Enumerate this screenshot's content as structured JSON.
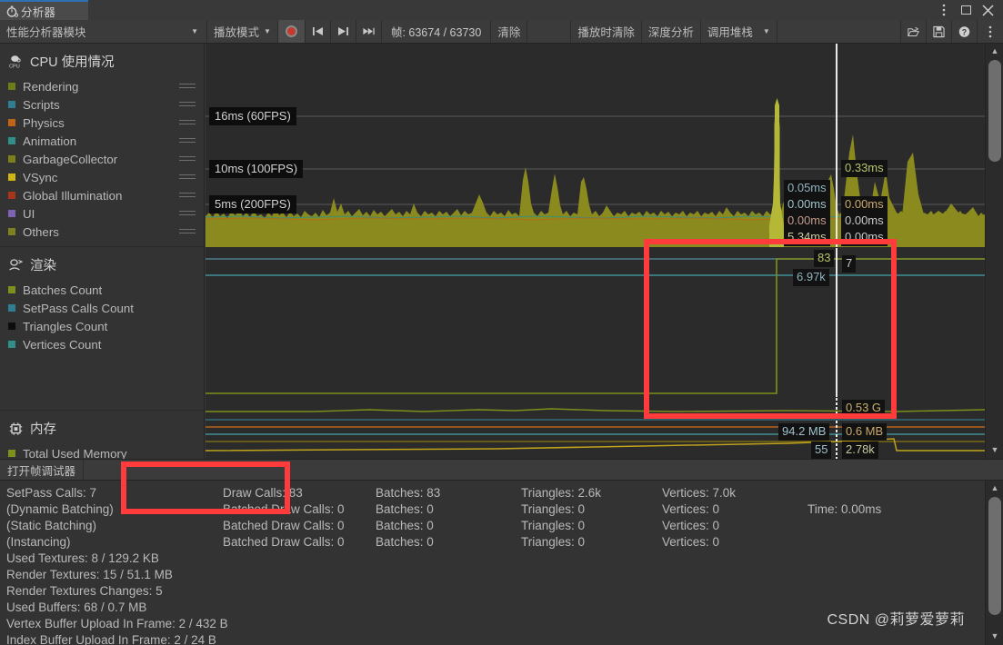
{
  "window": {
    "tab_label": "分析器",
    "tab_icon": "stopwatch-icon",
    "kebab": "⋮",
    "close": "✕"
  },
  "toolbar": {
    "modules_label": "性能分析器模块",
    "play_mode_label": "播放模式",
    "record_icon": "record-icon",
    "prev_frame_icon": "skip-to-start-icon",
    "next_frame_icon": "skip-to-end-icon",
    "last_frame_icon": "fast-forward-icon",
    "frame_label": "帧:  63674 / 63730",
    "clear_label": "清除",
    "clear_on_play_label": "播放时清除",
    "deep_profile_label": "深度分析",
    "call_stacks_label": "调用堆栈",
    "load_icon": "open-folder-icon",
    "save_icon": "save-icon",
    "help_icon": "help-icon",
    "menu_icon": "kebab-icon"
  },
  "modules": [
    {
      "title": "CPU 使用情况",
      "icon": "cpu-icon",
      "charts": [
        {
          "label": "Rendering",
          "color": "#6d7e16"
        },
        {
          "label": "Scripts",
          "color": "#2f7f92"
        },
        {
          "label": "Physics",
          "color": "#bf6415"
        },
        {
          "label": "Animation",
          "color": "#2f8f8a"
        },
        {
          "label": "GarbageCollector",
          "color": "#7e7f19"
        },
        {
          "label": "VSync",
          "color": "#cfb414"
        },
        {
          "label": "Global Illumination",
          "color": "#a83419"
        },
        {
          "label": "UI",
          "color": "#7d62b5"
        },
        {
          "label": "Others",
          "color": "#80801f"
        }
      ]
    },
    {
      "title": "渲染",
      "icon": "rendering-icon",
      "charts": [
        {
          "label": "Batches Count",
          "color": "#7f8f1b"
        },
        {
          "label": "SetPass Calls Count",
          "color": "#2f7f92"
        },
        {
          "label": "Triangles Count",
          "color": "#0d0d0d"
        },
        {
          "label": "Vertices Count",
          "color": "#2f8f8a"
        }
      ]
    },
    {
      "title": "内存",
      "icon": "memory-icon",
      "charts": [
        {
          "label": "Total Used Memory",
          "color": "#7f8f1b"
        }
      ]
    }
  ],
  "chart_data": {
    "type": "area",
    "title": "CPU 使用情况",
    "gridlines": [
      {
        "label": "16ms (60FPS)",
        "value": 16
      },
      {
        "label": "10ms (100FPS)",
        "value": 10
      },
      {
        "label": "5ms (200FPS)",
        "value": 5
      }
    ],
    "ylabel": "ms",
    "ylim": [
      0,
      22
    ],
    "selected_frame": 63674,
    "cpu_tooltips_left": [
      {
        "text": "0.05ms",
        "color": "#8fb3c0"
      },
      {
        "text": "0.00ms",
        "color": "#9fc2cc"
      },
      {
        "text": "0.00ms",
        "color": "#c49a8a"
      },
      {
        "text": "5.34ms",
        "color": "#c9c9a0"
      }
    ],
    "cpu_tooltips_right": [
      {
        "text": "0.33ms",
        "color": "#b8c26a"
      },
      {
        "text": "0.00ms",
        "color": "#c9a86a"
      },
      {
        "text": "0.00ms",
        "color": "#c8c8c8"
      },
      {
        "text": "0.00ms",
        "color": "#c8c8c8"
      }
    ],
    "render_tooltips_left": [
      {
        "text": "83",
        "color": "#b8c26a"
      },
      {
        "text": "6.97k",
        "color": "#8fb3c0"
      }
    ],
    "render_tooltips_right": [
      {
        "text": "7",
        "color": "#cfcfcf"
      }
    ],
    "memory_tooltips_left": [
      {
        "text": "94.2 MB",
        "color": "#9fc2cc"
      },
      {
        "text": "55",
        "color": "#9fc2cc"
      }
    ],
    "memory_tooltips_right": [
      {
        "text": "0.53 G",
        "color": "#c9b06a"
      },
      {
        "text": "0.6 MB",
        "color": "#c9a86a"
      },
      {
        "text": "2.78k",
        "color": "#c9c9a0"
      }
    ]
  },
  "frame_debugger": {
    "open_label": "打开帧调试器"
  },
  "stats": {
    "rows": [
      [
        "SetPass Calls: 7",
        "Draw Calls: 83",
        "Batches: 83",
        "Triangles: 2.6k",
        "Vertices: 7.0k",
        ""
      ],
      [
        "(Dynamic Batching)",
        "Batched Draw Calls: 0",
        "Batches: 0",
        "Triangles: 0",
        "Vertices: 0",
        "Time: 0.00ms"
      ],
      [
        "(Static Batching)",
        "Batched Draw Calls: 0",
        "Batches: 0",
        "Triangles: 0",
        "Vertices: 0",
        ""
      ],
      [
        "(Instancing)",
        "Batched Draw Calls: 0",
        "Batches: 0",
        "Triangles: 0",
        "Vertices: 0",
        ""
      ]
    ],
    "lines": [
      "Used Textures: 8 / 129.2 KB",
      "Render Textures: 15 / 51.1 MB",
      "Render Textures Changes: 5",
      "Used Buffers: 68 / 0.7 MB",
      "Vertex Buffer Upload In Frame: 2 / 432 B",
      "Index Buffer Upload In Frame: 2 / 24 B"
    ]
  },
  "watermark": "CSDN @莉萝爱萝莉",
  "colors": {
    "accent": "#2f6fb3",
    "annotation": "#ff3b3b",
    "panel": "#333333",
    "chart_bg": "#2b2b2b",
    "cpu_fill": "#8a8a1e"
  }
}
